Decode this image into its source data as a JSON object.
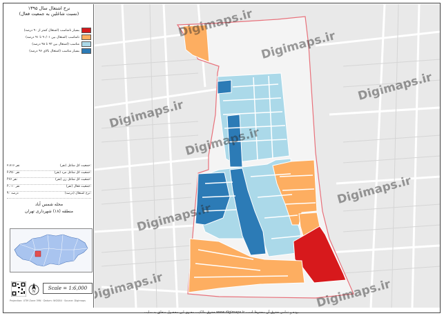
{
  "title": {
    "line1": "نرخ اشتغال سال ۱۳۹۵",
    "line2": "(نسبت شاغلین به جمعیت فعال)"
  },
  "legend": [
    {
      "label": "بسیار نامناسب (اشتغال کمتر از ۹۰ درصد)",
      "color": "#d7191c"
    },
    {
      "label": "نامناسب (اشتغال بین ۹۰/۰۱ تا ۹۱ درصد)",
      "color": "#fdae61"
    },
    {
      "label": "مناسب (اشتغال بین ۹۲ تا ۹۸ درصد)",
      "color": "#abd9e9"
    },
    {
      "label": "بسیار مناسب (اشتغال بالای ۹۶ درصد)",
      "color": "#2c7bb6"
    }
  ],
  "stats": [
    {
      "label": "جمعیت کل شاغل (نفر):",
      "value": "۲،۷۱۶ نفر"
    },
    {
      "label": "جمعیت کل شاغل مرد (نفر):",
      "value": "۲،۳۵۰ نفر"
    },
    {
      "label": "جمعیت کل شاغل زن (نفر):",
      "value": "۳۶۶ نفر"
    },
    {
      "label": "جمعیت فعال (نفر):",
      "value": "۳،۰۱۰ نفر"
    },
    {
      "label": "نرخ اشتغال (درصد):",
      "value": "۹۰ درصد"
    }
  ],
  "area": {
    "name": "محله شمس آباد",
    "district": "منطقه (۱۸) شهرداری تهران"
  },
  "scale": "Scale = 1:6,000",
  "watermark": "Digimaps.ir",
  "copyright": "حقوق مالکیت معنوی این محصول متعلق به سایت www.digimaps.ir بوده و تمامی حقوق آن محفوظ است.",
  "mini_credit": "Projection: UTM Zone 39N · Datum: WGS84 · Source: Digimaps",
  "colors": {
    "very_poor": "#d7191c",
    "poor": "#fdae61",
    "good": "#abd9e9",
    "very_good": "#2c7bb6",
    "boundary": "#e8707a"
  }
}
